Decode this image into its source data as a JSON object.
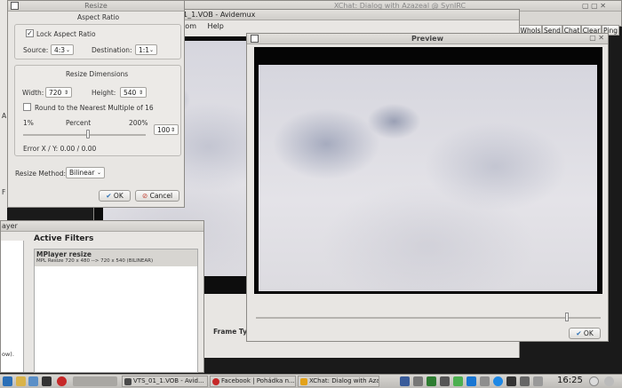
{
  "xchat": {
    "title": "XChat: Dialog with Azazeal @ SynIRC",
    "buttons": [
      "WhoIs",
      "Send",
      "Chat",
      "Clear",
      "Ping"
    ]
  },
  "avidemux": {
    "title": "1_1.VOB - Avidemux",
    "menu": [
      "stom",
      "Help"
    ],
    "frame_type_label": "Frame Ty"
  },
  "preview": {
    "title": "Preview",
    "ok_label": "OK"
  },
  "resize": {
    "title": "Resize",
    "aspect_ratio_title": "Aspect Ratio",
    "lock_aspect_label": "Lock Aspect Ratio",
    "lock_aspect_checked": true,
    "source_label": "Source:",
    "source_value": "4:3",
    "destination_label": "Destination:",
    "destination_value": "1:1",
    "resize_dimensions_title": "Resize Dimensions",
    "width_label": "Width:",
    "width_value": "720",
    "height_label": "Height:",
    "height_value": "540",
    "round_label": "Round to the Nearest Multiple of 16",
    "round_checked": false,
    "pct_min": "1%",
    "pct_label": "Percent",
    "pct_max": "200%",
    "pct_value": "100",
    "error_label": "Error X / Y: 0.00 / 0.00",
    "method_label": "Resize Method:",
    "method_value": "Bilinear",
    "ok_label": "OK",
    "cancel_label": "Cancel"
  },
  "filters": {
    "left_title": "ayer",
    "title": "Active Filters",
    "items": [
      {
        "name": "MPlayer resize",
        "desc": "MPL Resize 720 x 480 --> 720 x 540 (BILINEAR)"
      }
    ],
    "left_fragment": "ow)."
  },
  "left_fragments": {
    "a": "A",
    "f": "F"
  },
  "taskbar": {
    "tasks": [
      "VTS_01_1.VOB - Avid...",
      "Facebook | Pohádka n...",
      "XChat: Dialog with Azaz..."
    ],
    "clock": "16:25"
  }
}
